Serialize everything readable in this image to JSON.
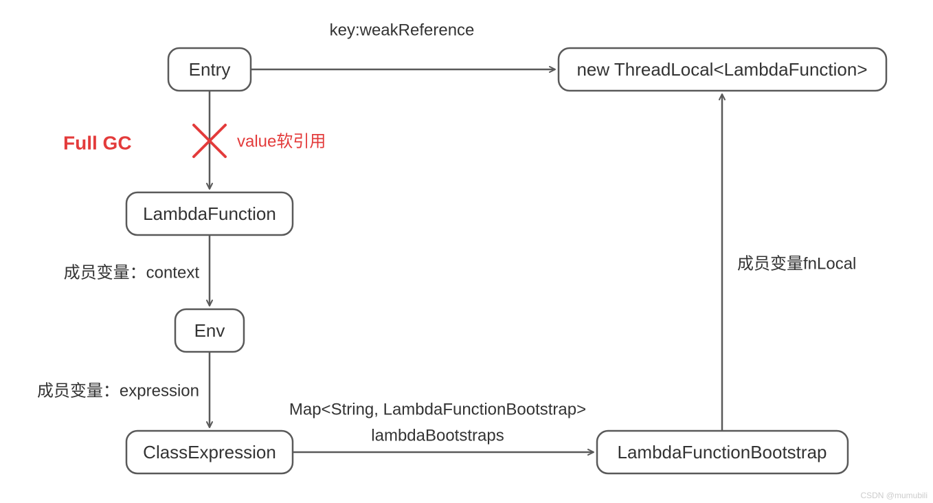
{
  "diagram": {
    "nodes": {
      "entry": "Entry",
      "threadlocal": "new ThreadLocal<LambdaFunction>",
      "lambdafunction": "LambdaFunction",
      "env": "Env",
      "classexpression": "ClassExpression",
      "bootstrap": "LambdaFunctionBootstrap"
    },
    "edges": {
      "key_weak_ref": "key:weakReference",
      "value_soft_ref": "value软引用",
      "member_context": "成员变量：context",
      "member_expression": "成员变量：expression",
      "map_type": "Map<String, LambdaFunctionBootstrap>",
      "lambda_bootstraps": "lambdaBootstraps",
      "member_fnlocal": "成员变量fnLocal"
    },
    "annotations": {
      "full_gc": "Full GC"
    },
    "watermark": "CSDN @mumubili"
  }
}
